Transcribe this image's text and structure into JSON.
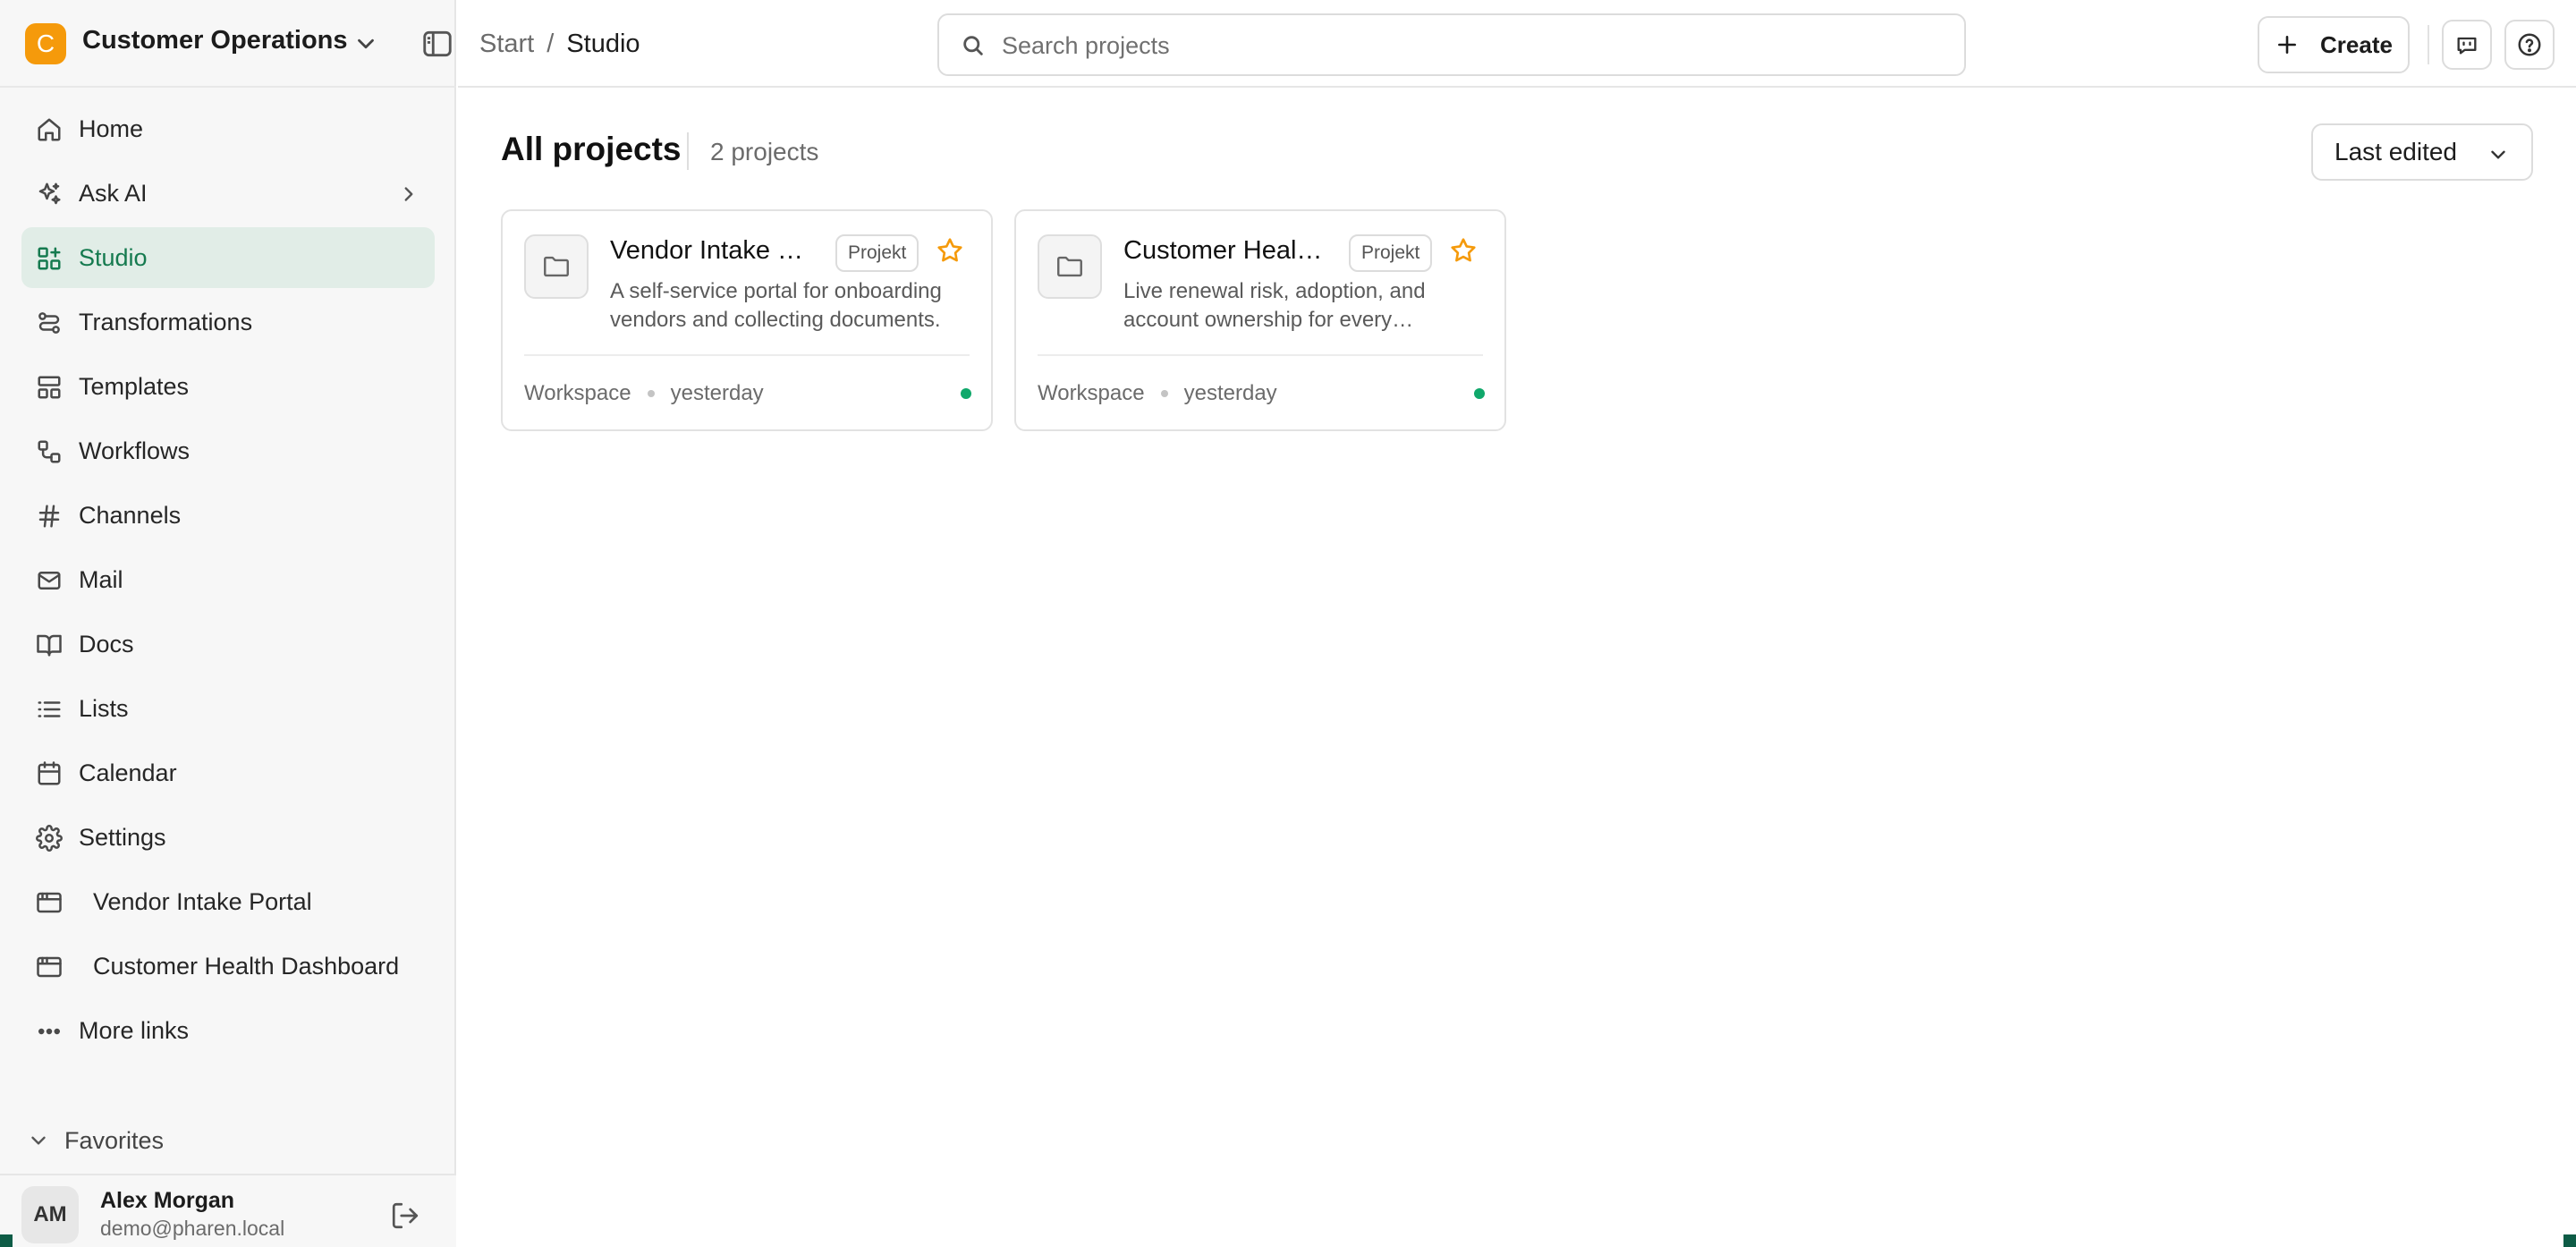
{
  "workspace": {
    "initial": "C",
    "name": "Customer Operations",
    "logo_color": "#f59a0b"
  },
  "sidebar": {
    "items": [
      {
        "label": "Home",
        "icon": "home-icon"
      },
      {
        "label": "Ask AI",
        "icon": "sparkle-icon"
      },
      {
        "label": "Studio",
        "icon": "grid-icon",
        "active": true
      },
      {
        "label": "Transformations",
        "icon": "transform-icon"
      },
      {
        "label": "Templates",
        "icon": "template-icon"
      },
      {
        "label": "Workflows",
        "icon": "workflow-icon"
      },
      {
        "label": "Channels",
        "icon": "hash-icon"
      },
      {
        "label": "Mail",
        "icon": "mail-icon"
      },
      {
        "label": "Docs",
        "icon": "book-icon"
      },
      {
        "label": "Lists",
        "icon": "list-icon"
      },
      {
        "label": "Calendar",
        "icon": "calendar-icon"
      },
      {
        "label": "Settings",
        "icon": "gear-icon"
      }
    ],
    "links": [
      {
        "label": "Vendor Intake Portal",
        "icon": "app-window-icon"
      },
      {
        "label": "Customer Health Dashboard",
        "icon": "app-window-icon"
      }
    ],
    "more_links": "More links",
    "favorites": "Favorites",
    "active_color": "#157a4f"
  },
  "user": {
    "initials": "AM",
    "name": "Alex Morgan",
    "email": "demo@pharen.local"
  },
  "topbar": {
    "breadcrumb_start": "Start",
    "breadcrumb_sep": "/",
    "breadcrumb_current": "Studio",
    "search_placeholder": "Search projects",
    "create_label": "Create"
  },
  "main": {
    "title": "All projects",
    "count": "2 projects",
    "sort_label": "Last edited",
    "projects": [
      {
        "title": "Vendor Intake Portal",
        "badge": "Projekt",
        "description": "A self-service portal for onboarding vendors and collecting documents.",
        "location": "Workspace",
        "edited": "yesterday",
        "status_color": "#10a86b"
      },
      {
        "title": "Customer Health Dashboard",
        "badge": "Projekt",
        "description": "Live renewal risk, adoption, and account ownership for every customer.",
        "location": "Workspace",
        "edited": "yesterday",
        "status_color": "#10a86b"
      }
    ]
  }
}
